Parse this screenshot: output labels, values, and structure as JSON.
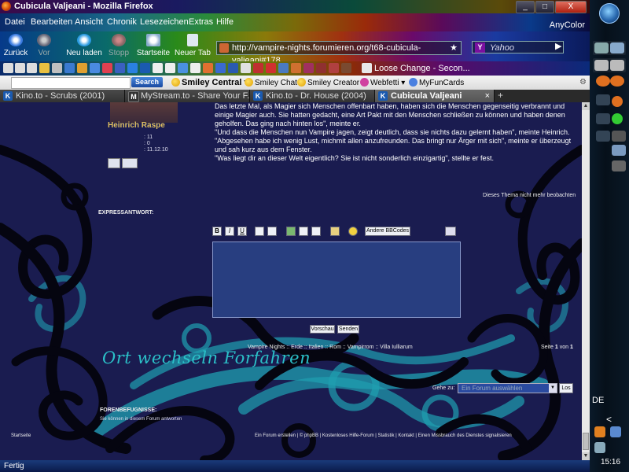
{
  "window": {
    "title": "Cubicula Valjeani - Mozilla Firefox",
    "buttons": [
      "_",
      "□",
      "X"
    ]
  },
  "menu": {
    "items": [
      "Datei",
      "Bearbeiten",
      "Ansicht",
      "Chronik",
      "Lesezeichen",
      "Extras",
      "Hilfe"
    ],
    "brand": "AnyColor"
  },
  "nav": {
    "back": "Zurück",
    "forward": "Vor",
    "reload": "Neu laden",
    "stop": "Stopp",
    "home": "Startseite",
    "new_tab": "Neuer Tab",
    "url": "http://vampire-nights.forumieren.org/t68-cubicula-valjeani#178",
    "search_placeholder": "Yahoo"
  },
  "bookmarks": {
    "live_label": "Loose Change - Secon..."
  },
  "toolbar2": {
    "search_btn": "Search",
    "smiley_central": "Smiley Central",
    "smiley_chat": "Smiley Chat",
    "smiley_creator": "Smiley Creator",
    "webfetti": "Webfetti",
    "myfuncards": "MyFunCards"
  },
  "tabs": [
    {
      "label": "Kino.to - Scrubs (2001)",
      "icon": "K"
    },
    {
      "label": "MyStream.to - Share Your F...",
      "icon": "M"
    },
    {
      "label": "Kino.to - Dr. House (2004)",
      "icon": "K"
    },
    {
      "label": "Cubicula Valjeani",
      "icon": "K"
    }
  ],
  "post": {
    "author": "Heinrich Raspe",
    "stats": [
      ": 11",
      ": 0",
      ": 11.12.10"
    ],
    "paragraphs": [
      "Das letzte Mal, als Magier sich Menschen offenbart haben, haben sich die Menschen gegenseitig verbrannt und einige Magier auch. Sie hatten gedacht, eine Art Pakt mit den Menschen schließen zu können und haben denen geholfen. Das ging nach hinten los\", meinte er.",
      "\"Und dass die Menschen nun Vampire jagen, zeigt deutlich, dass sie nichts dazu gelernt haben\", meinte Heinrich.",
      "\"Abgesehen habe ich wenig Lust, michmit allen anzufreunden. Das bringt nur Ärger mit sich\", meinte er überzeugt und sah kurz aus dem Fenster.",
      "\"Was liegt dir an dieser Welt eigentlich? Sie ist nicht sonderlich einzigartig\", stellte er fest."
    ]
  },
  "forum": {
    "watch_topic": "Dieses Thema nicht mehr beobachten",
    "quick_reply": "EXPRESSANTWORT:",
    "bb_buttons": [
      "B",
      "I",
      "U",
      "",
      "",
      "",
      "",
      "",
      "",
      ""
    ],
    "bb_more": "Andere BBCodes",
    "preview": "Vorschau",
    "send": "Senden",
    "breadcrumb": "Vampire Nights :: Erde :: Italien :: Rom :: Vampirrom :: Villa Iulliarum",
    "pages_prefix": "Seite",
    "page_current": "1",
    "pages_mid": "von",
    "page_total": "1",
    "script_title": "Ort wechseln  Forfahren",
    "jump_label": "Gehe zu:",
    "jump_selected": "Ein Forum auswählen",
    "jump_go": "Los",
    "permissions_title": "FORENBEFUGNISSE:",
    "permissions_text": "Sie können in diesem Forum antworten",
    "footer_home": "Startseite",
    "footer_links": "Ein Forum erstellen  |  ©  phpBB  |  Kostenloses Hilfe-Forum  |  Statistik  |  Kontakt  |  Einen Missbrauch des Dienstes signalisieren"
  },
  "status": {
    "text": "Fertig"
  },
  "taskbar": {
    "language": "DE",
    "clock": "15:16"
  }
}
